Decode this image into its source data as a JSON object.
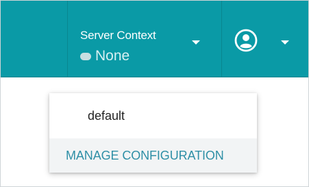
{
  "header": {
    "server_context": {
      "title": "Server Context",
      "value": "None",
      "status_color": "#c7dfe1"
    },
    "user_icon": "account-circle-icon",
    "dropdown_icon": "caret-down-icon",
    "background_color": "#0a9aa6"
  },
  "menu": {
    "items": [
      {
        "label": "default"
      },
      {
        "label": "MANAGE CONFIGURATION",
        "color": "#2e8fa6"
      }
    ]
  }
}
